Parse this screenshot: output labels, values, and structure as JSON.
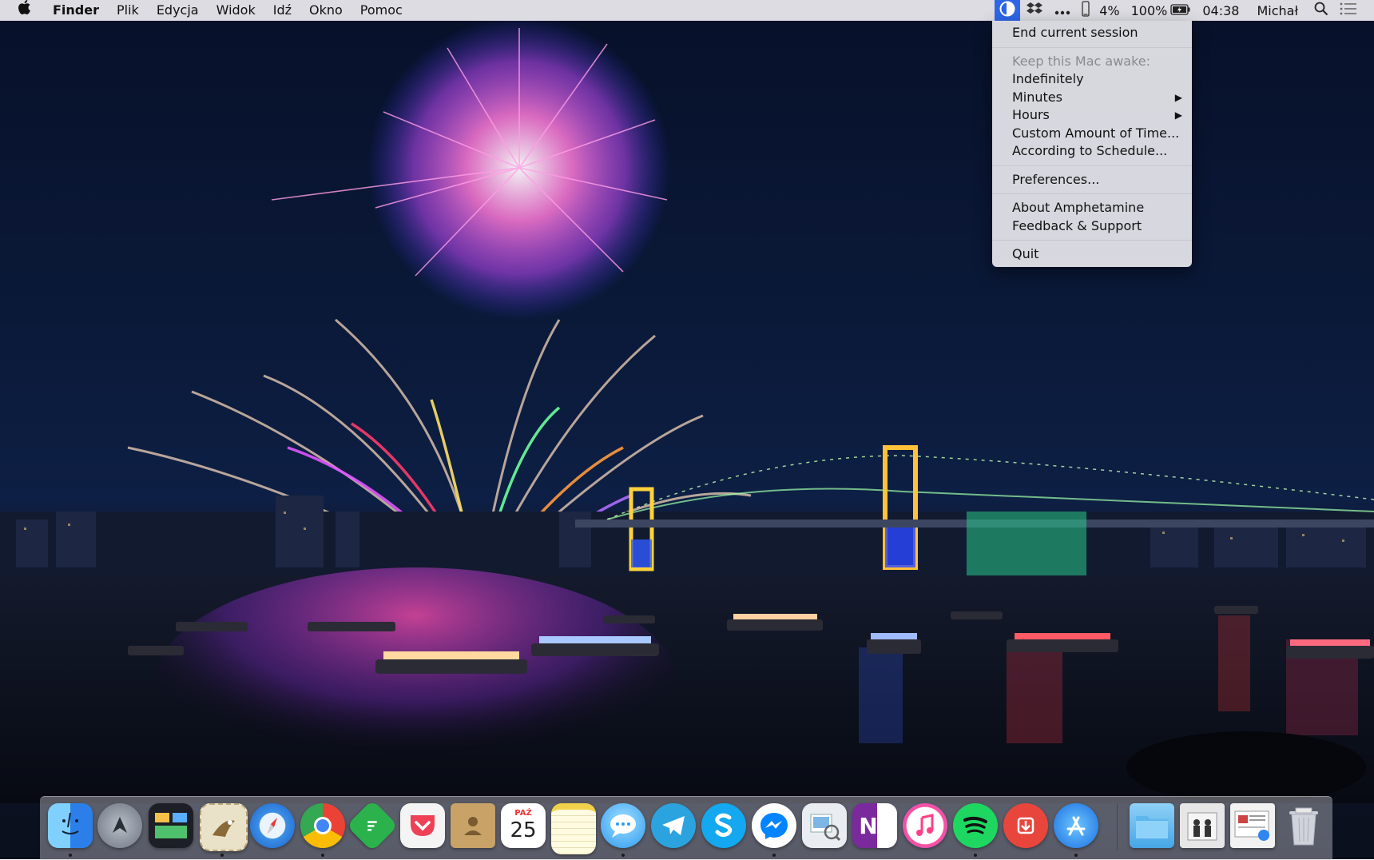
{
  "menubar": {
    "apple_icon": "apple-logo-icon",
    "app_name": "Finder",
    "menus": [
      "Plik",
      "Edycja",
      "Widok",
      "Idź",
      "Okno",
      "Pomoc"
    ],
    "status": {
      "amphetamine_icon": "pill-icon",
      "extra_icon": "dropbox-icon",
      "more_icon": "ellipsis-icon",
      "phone_icon": "phone-battery-icon",
      "phone_battery": "4%",
      "battery": "100%",
      "battery_icon": "battery-charging-icon",
      "time": "04:38",
      "user": "Michał",
      "search_icon": "spotlight-search-icon",
      "notifications_icon": "notification-center-icon"
    },
    "accent_color": "#2f66e8"
  },
  "dropdown": {
    "end_session": "End current session",
    "keep_awake_header": "Keep this Mac awake:",
    "indefinitely": "Indefinitely",
    "minutes": "Minutes",
    "hours": "Hours",
    "submenu_arrow": "▶",
    "custom_time": "Custom Amount of Time...",
    "schedule": "According to Schedule...",
    "preferences": "Preferences...",
    "about": "About Amphetamine",
    "feedback": "Feedback & Support",
    "quit": "Quit"
  },
  "dock": {
    "calendar": {
      "month": "PAŹ",
      "day": "25"
    },
    "apps": [
      {
        "name": "Finder",
        "icon": "finder-icon",
        "running": true
      },
      {
        "name": "Launchpad",
        "icon": "launchpad-icon",
        "running": false
      },
      {
        "name": "Mission Control",
        "icon": "mission-control-icon",
        "running": false
      },
      {
        "name": "Mail",
        "icon": "mail-stamp-icon",
        "running": true
      },
      {
        "name": "Safari",
        "icon": "safari-compass-icon",
        "running": false
      },
      {
        "name": "Chrome",
        "icon": "chrome-icon",
        "running": true
      },
      {
        "name": "Feedly",
        "icon": "feedly-icon",
        "running": false
      },
      {
        "name": "Pocket",
        "icon": "pocket-icon",
        "running": false
      },
      {
        "name": "Contacts",
        "icon": "contacts-icon",
        "running": false
      },
      {
        "name": "Calendar",
        "icon": "calendar-icon",
        "running": false
      },
      {
        "name": "Notes",
        "icon": "notes-icon",
        "running": false
      },
      {
        "name": "Messages",
        "icon": "messages-icon",
        "running": true
      },
      {
        "name": "Telegram",
        "icon": "telegram-icon",
        "running": false
      },
      {
        "name": "Skype",
        "icon": "skype-icon",
        "running": false
      },
      {
        "name": "Messenger",
        "icon": "messenger-icon",
        "running": true
      },
      {
        "name": "Preview",
        "icon": "preview-icon",
        "running": false
      },
      {
        "name": "OneNote",
        "icon": "onenote-icon",
        "running": false
      },
      {
        "name": "iTunes",
        "icon": "itunes-icon",
        "running": false
      },
      {
        "name": "Spotify",
        "icon": "spotify-icon",
        "running": true
      },
      {
        "name": "Transmit",
        "icon": "transmit-icon",
        "running": false
      },
      {
        "name": "App Store",
        "icon": "app-store-icon",
        "running": true
      },
      {
        "name": "Folder",
        "icon": "folder-icon",
        "running": false
      },
      {
        "name": "Downloads stack",
        "icon": "stack-icon",
        "running": false
      },
      {
        "name": "Documents stack",
        "icon": "documents-stack-icon",
        "running": false
      },
      {
        "name": "Trash",
        "icon": "trash-icon",
        "running": false
      }
    ]
  }
}
